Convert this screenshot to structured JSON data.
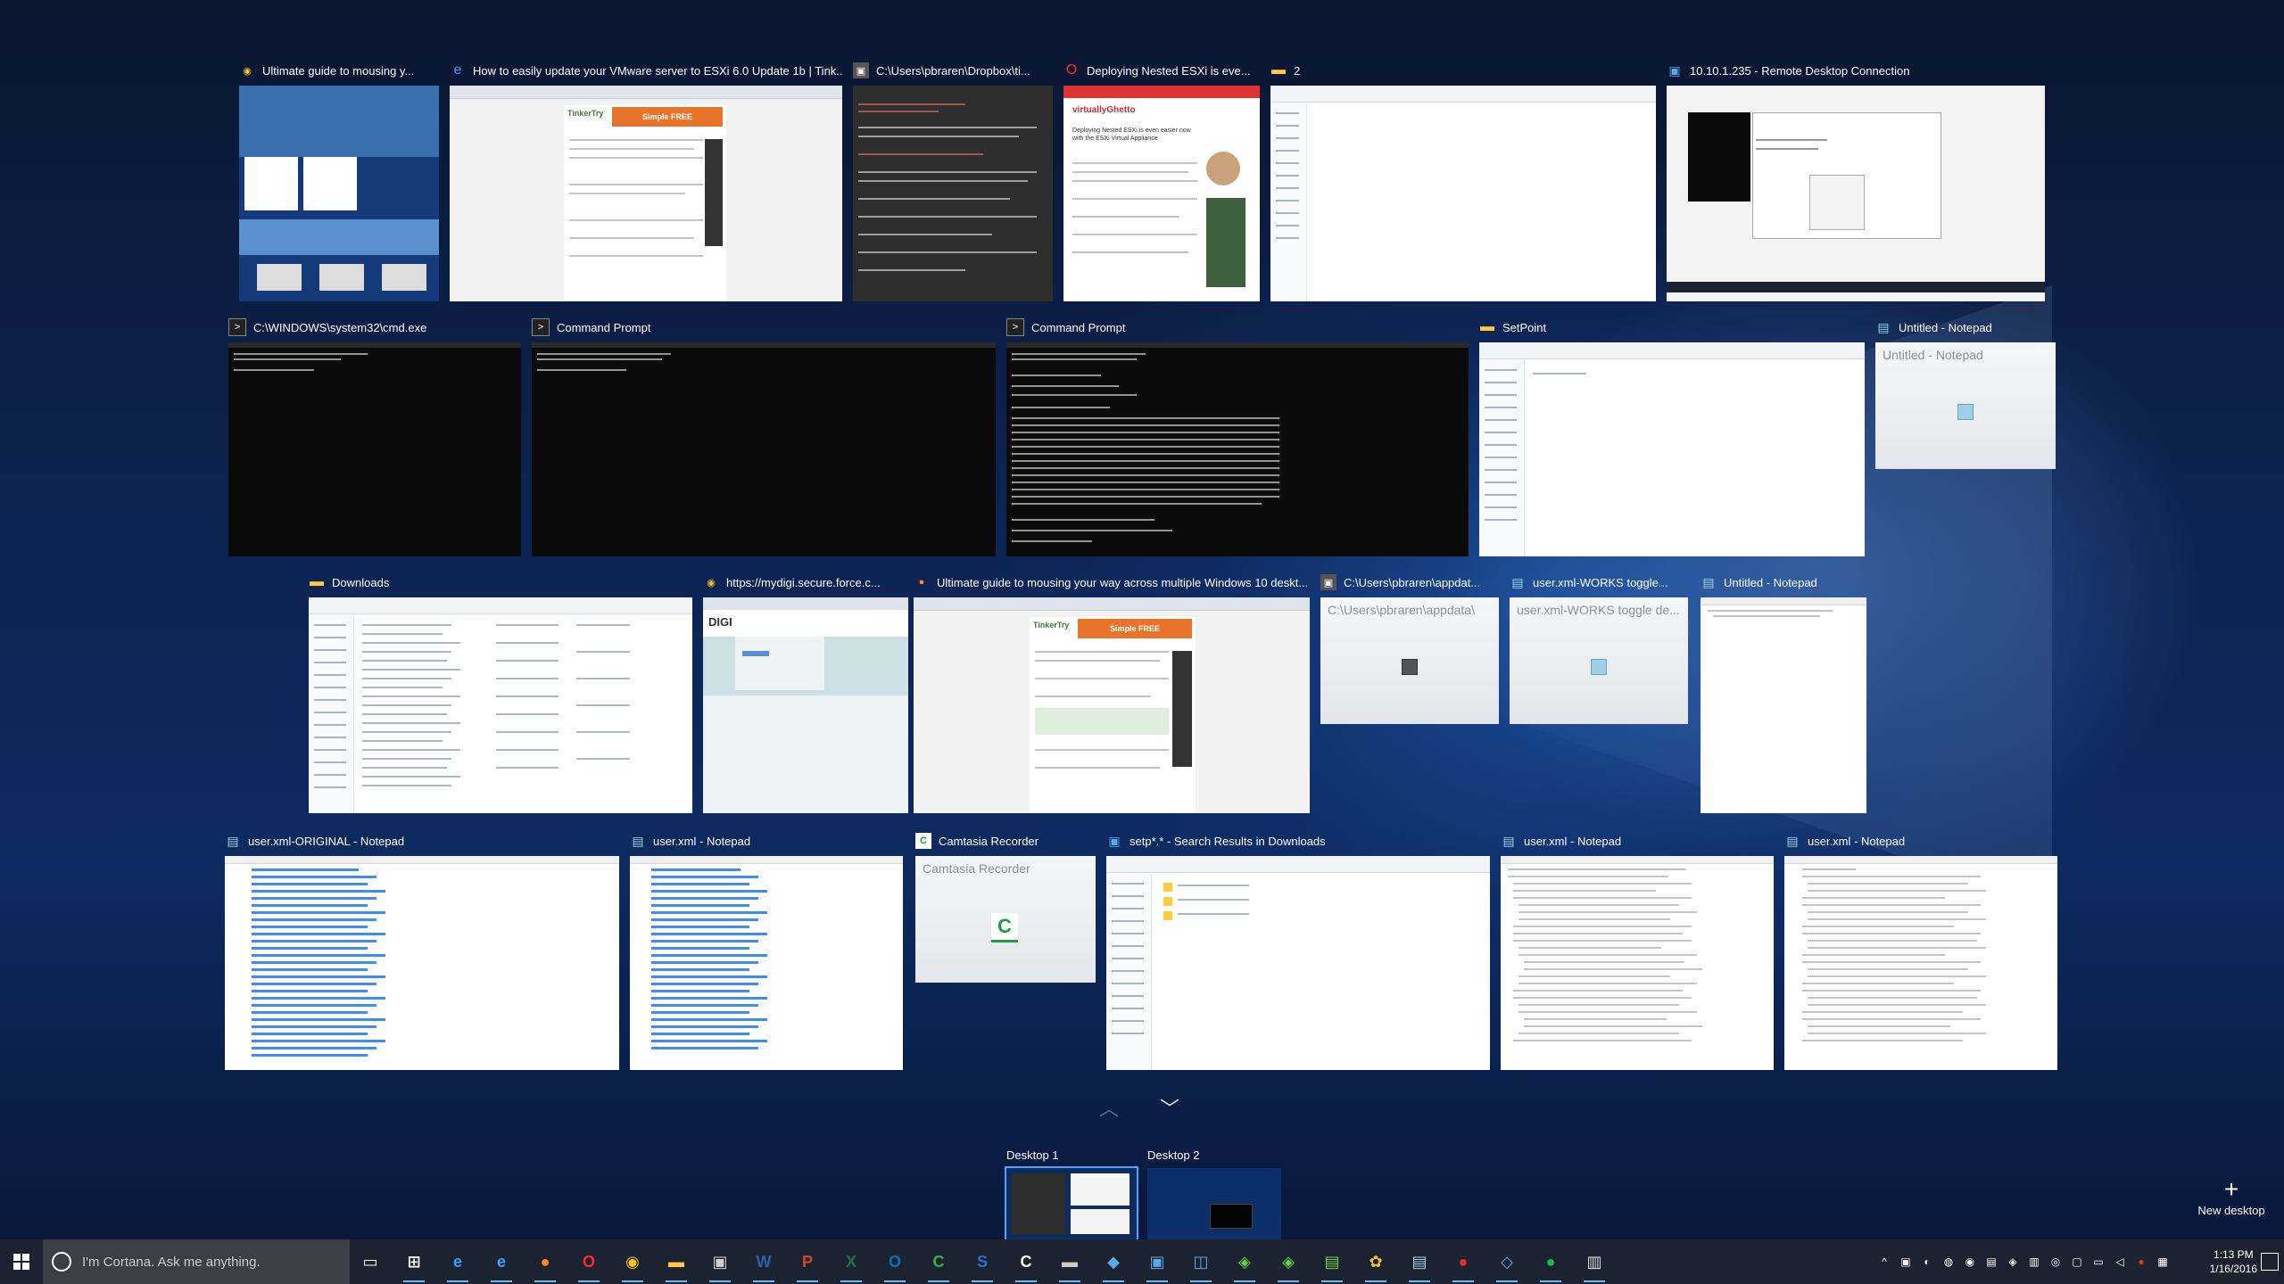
{
  "windows": {
    "chrome_mouse": "Ultimate guide to mousing y...",
    "edge_vmware": "How to easily update your VMware server to ESXi 6.0 Update 1b | Tink...",
    "dropbox_path": "C:\\Users\\pbraren\\Dropbox\\ti...",
    "opera_nested": "Deploying Nested ESXi is eve...",
    "folder_2": "2",
    "rdp": "10.10.1.235 - Remote Desktop Connection",
    "cmd_system32": "C:\\WINDOWS\\system32\\cmd.exe",
    "cmd_prompt_1": "Command Prompt",
    "cmd_prompt_2": "Command Prompt",
    "setpoint": "SetPoint",
    "notepad_untitled_1": "Untitled - Notepad",
    "notepad_untitled_1_inner": "Untitled - Notepad",
    "downloads": "Downloads",
    "mydigi": "https://mydigi.secure.force.c...",
    "firefox_mouse": "Ultimate guide to mousing your way across multiple Windows 10 deskt...",
    "appdata": "C:\\Users\\pbraren\\appdat...",
    "appdata_inner": "C:\\Users\\pbraren\\appdata\\",
    "user_works": "user.xml-WORKS toggle...",
    "user_works_inner": "user.xml-WORKS toggle de...",
    "notepad_untitled_2": "Untitled - Notepad",
    "user_original": "user.xml-ORIGINAL - Notepad",
    "user_xml_1": "user.xml - Notepad",
    "camtasia": "Camtasia Recorder",
    "camtasia_inner": "Camtasia Recorder",
    "setp_search": "setp*.* - Search Results in Downloads",
    "user_xml_2": "user.xml - Notepad",
    "user_xml_3": "user.xml - Notepad"
  },
  "thumbnail_text": {
    "virtualghetto_logo": "virtuallyGhetto",
    "virtualghetto_heading": "Deploying Nested ESXi is even easier now with the ESXi Virtual Appliance",
    "tinkertry_logo": "TinkerTry",
    "tinkertry_banner": "Simple FREE",
    "digi_logo": "DIGI"
  },
  "desktops": {
    "items": [
      {
        "label": "Desktop 1"
      },
      {
        "label": "Desktop 2"
      }
    ],
    "new_desktop_label": "New desktop",
    "new_desktop_icon": "+"
  },
  "taskbar": {
    "search_placeholder": "I'm Cortana. Ask me anything.",
    "icons": [
      {
        "name": "task-view-icon",
        "glyph": "▭",
        "color": "#ffffff"
      },
      {
        "name": "store-icon",
        "glyph": "⊞",
        "color": "#ffffff"
      },
      {
        "name": "ie-icon",
        "glyph": "e",
        "color": "#3aa0ff"
      },
      {
        "name": "edge-icon",
        "glyph": "e",
        "color": "#3aa0ff"
      },
      {
        "name": "firefox-icon",
        "glyph": "●",
        "color": "#ff8a1d"
      },
      {
        "name": "opera-icon",
        "glyph": "O",
        "color": "#ff2a2a"
      },
      {
        "name": "chrome-icon",
        "glyph": "◉",
        "color": "#f5c518"
      },
      {
        "name": "file-explorer-icon",
        "glyph": "▬",
        "color": "#ffc940"
      },
      {
        "name": "app-icon",
        "glyph": "▣",
        "color": "#cfcfcf"
      },
      {
        "name": "word-icon",
        "glyph": "W",
        "color": "#2b5fb4"
      },
      {
        "name": "powerpoint-icon",
        "glyph": "P",
        "color": "#d24726"
      },
      {
        "name": "excel-icon",
        "glyph": "X",
        "color": "#1e7145"
      },
      {
        "name": "outlook-icon",
        "glyph": "O",
        "color": "#0a6fc2"
      },
      {
        "name": "camtasia-studio-icon",
        "glyph": "C",
        "color": "#33b14a"
      },
      {
        "name": "snagit-icon",
        "glyph": "S",
        "color": "#2a6fd6"
      },
      {
        "name": "camtasia-recorder-icon",
        "glyph": "C",
        "color": "#ffffff"
      },
      {
        "name": "cmd-icon",
        "glyph": "▬",
        "color": "#cccccc"
      },
      {
        "name": "app-icon-2",
        "glyph": "◆",
        "color": "#5aa8e8"
      },
      {
        "name": "rdp-icon",
        "glyph": "▣",
        "color": "#5aa8e8"
      },
      {
        "name": "app-icon-3",
        "glyph": "◫",
        "color": "#5aa8e8"
      },
      {
        "name": "app-icon-4",
        "glyph": "◈",
        "color": "#6ccf46"
      },
      {
        "name": "app-icon-5",
        "glyph": "◈",
        "color": "#6ccf46"
      },
      {
        "name": "app-icon-6",
        "glyph": "▤",
        "color": "#6ccf46"
      },
      {
        "name": "paint-icon",
        "glyph": "✿",
        "color": "#f0c030"
      },
      {
        "name": "notepad-icon",
        "glyph": "▤",
        "color": "#9fd0e8"
      },
      {
        "name": "app-icon-7",
        "glyph": "●",
        "color": "#e03030"
      },
      {
        "name": "network-app-icon",
        "glyph": "◇",
        "color": "#5aa8e8"
      },
      {
        "name": "spotify-icon",
        "glyph": "●",
        "color": "#1db954"
      },
      {
        "name": "app-icon-8",
        "glyph": "▥",
        "color": "#dddddd"
      }
    ],
    "time": "1:13 PM",
    "date": "1/16/2016"
  },
  "colors": {
    "accent": "#4aa6ff",
    "taskbar": "#1c2330"
  }
}
